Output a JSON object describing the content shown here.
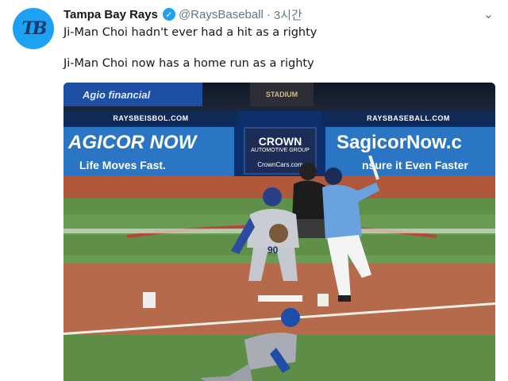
{
  "tweet": {
    "account_name": "Tampa Bay Rays",
    "handle": "@RaysBaseball",
    "separator": "·",
    "timestamp": "3시간",
    "avatar_text": "TB",
    "menu_icon": "chevron-down-icon",
    "verified_icon": "verified-badge-icon",
    "line1": "Ji-Man Choi hadn't ever had a hit as a righty",
    "line2": "Ji-Man Choi now has a home run as a righty"
  },
  "video": {
    "board_top_left": "Agio financial",
    "board_top_center": "STADIUM",
    "ribbon_left": "RAYSBEISBOL.COM",
    "ribbon_right": "RAYSBASEBALL.COM",
    "ad_left_main": "AGICOR NOW",
    "ad_left_sub": "Life Moves Fast.",
    "ad_center_title": "CROWN",
    "ad_center_sub": "AUTOMOTIVE GROUP",
    "ad_center_url": "CrownCars.com",
    "ad_right_main": "SagicorNow.c",
    "ad_right_sub": "nsure it Even Faster",
    "field_logo": "RAYS",
    "catcher_number": "90"
  },
  "colors": {
    "verified": "#1da1f2",
    "avatar_bg": "#1da1f2",
    "ad_blue": "#2b76c4",
    "grass": "#5f8f49",
    "dirt": "#b56a4c"
  }
}
